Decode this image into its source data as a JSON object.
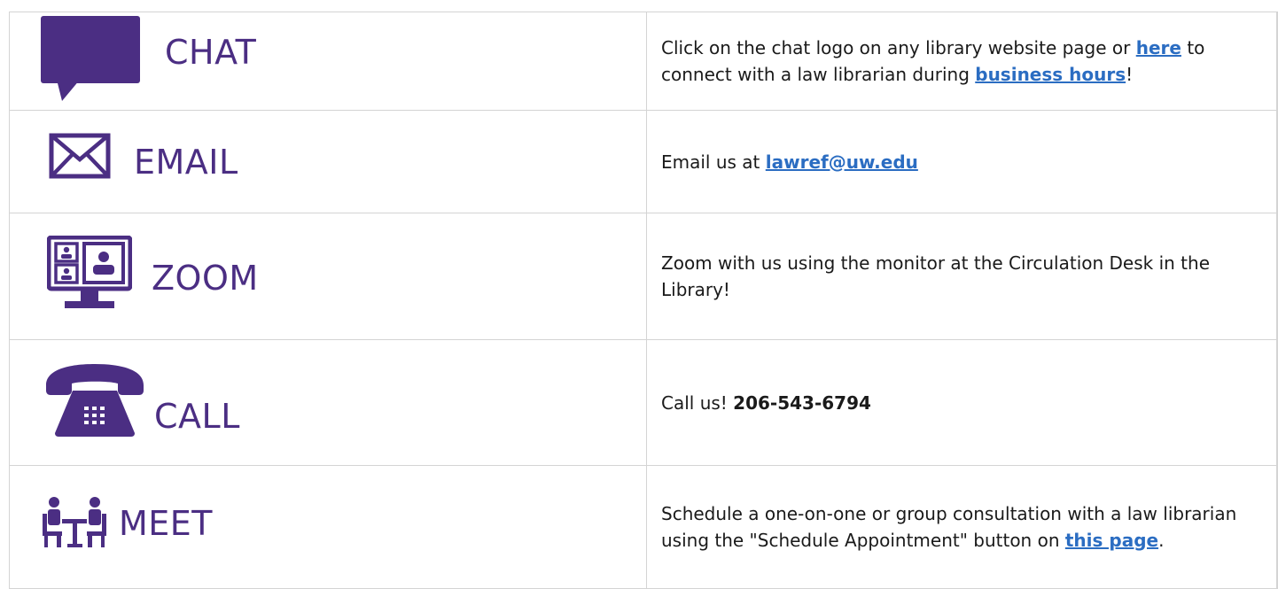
{
  "colors": {
    "icon_purple": "#4b2e83",
    "link_blue": "#2b6dc2",
    "border_gray": "#d4d4d4",
    "text": "#1a1a1a"
  },
  "rows": {
    "chat": {
      "label": "CHAT",
      "icon": "chat-bubble-icon",
      "text_1": "Click on the chat logo on any library website page or ",
      "link_1": "here",
      "text_2": " to connect with a law librarian during ",
      "link_2": "business hours",
      "text_3": "!"
    },
    "email": {
      "label": "EMAIL",
      "icon": "envelope-icon",
      "text_1": "Email us at ",
      "link_1": "lawref@uw.edu"
    },
    "zoom": {
      "label": "ZOOM",
      "icon": "video-monitor-icon",
      "text_1": "Zoom with us using the monitor at the Circulation Desk in the Library!"
    },
    "call": {
      "label": "CALL",
      "icon": "telephone-icon",
      "text_1": "Call us! ",
      "phone": "206-543-6794"
    },
    "meet": {
      "label": "MEET",
      "icon": "meeting-icon",
      "text_1": "Schedule a one-on-one or group consultation with a law librarian using the \"Schedule Appointment\" button on ",
      "link_1": "this page",
      "text_2": "."
    }
  }
}
